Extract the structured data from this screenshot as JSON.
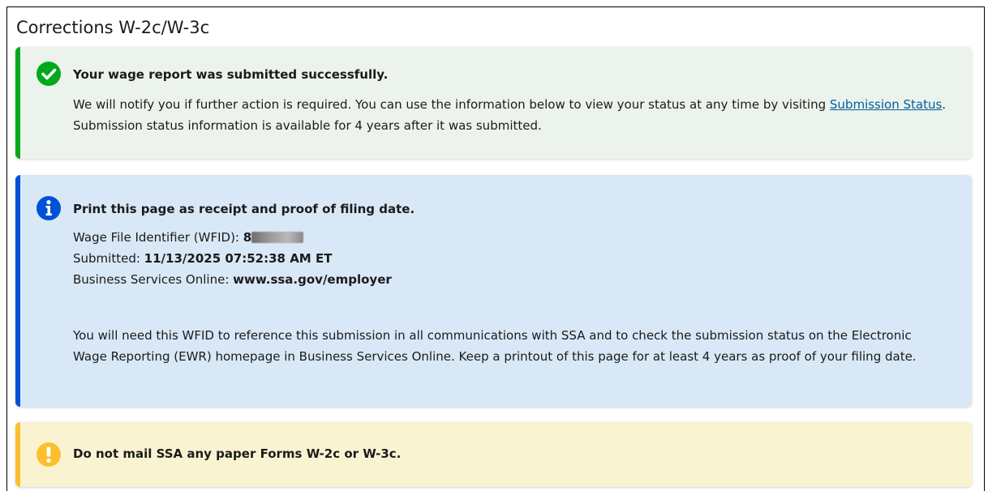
{
  "page": {
    "title": "Corrections W-2c/W-3c"
  },
  "success_alert": {
    "heading": "Your wage report was submitted successfully.",
    "body_before_link": "We will notify you if further action is required. You can use the information below to view your status at any time by visiting ",
    "link_label": "Submission Status",
    "body_after_link": ". Submission status information is available for 4 years after it was submitted.",
    "icon": "check-circle-icon",
    "accent_color": "#00a91c",
    "background_color": "#ecf3ec"
  },
  "info_alert": {
    "heading": "Print this page as receipt and proof of filing date.",
    "wfid_label": "Wage File Identifier (WFID): ",
    "wfid_value_visible": "8",
    "submitted_label": "Submitted: ",
    "submitted_value": "11/13/2025 07:52:38 AM ET",
    "bso_label": "Business Services Online: ",
    "bso_value": "www.ssa.gov/employer",
    "note": "You will need this WFID to reference this submission in all communications with SSA and to check the submission status on the Electronic Wage Reporting (EWR) homepage in Business Services Online. Keep a printout of this page for at least 4 years as proof of your filing date.",
    "icon": "info-circle-icon",
    "accent_color": "#0050d8",
    "background_color": "#d9e8f6"
  },
  "warning_alert": {
    "heading": "Do not mail SSA any paper Forms W-2c or W-3c.",
    "icon": "exclamation-circle-icon",
    "accent_color": "#ffbe2e",
    "background_color": "#faf3d1"
  }
}
